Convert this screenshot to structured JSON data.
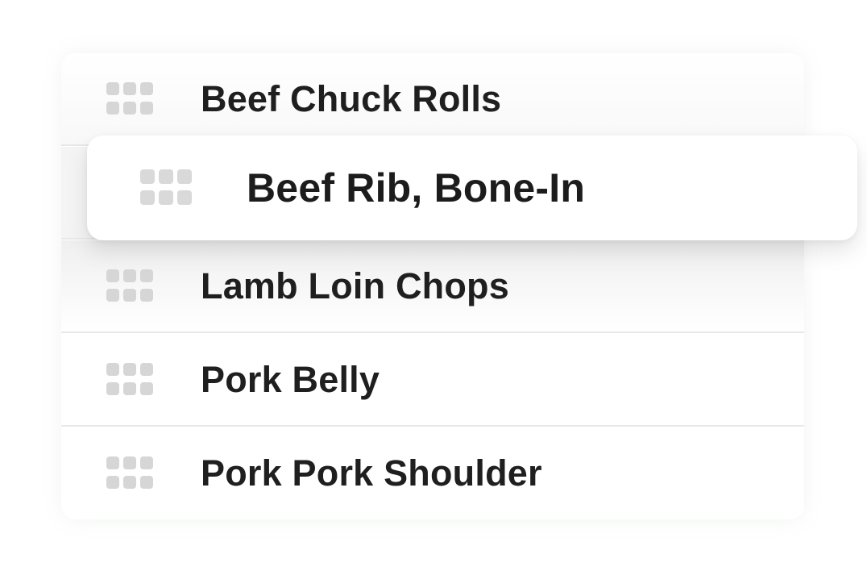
{
  "list": {
    "items": [
      {
        "label": "Beef Chuck Rolls",
        "handle_icon": "drag-handle-icon"
      },
      {
        "label": "",
        "handle_icon": ""
      },
      {
        "label": "Lamb Loin Chops",
        "handle_icon": "drag-handle-icon"
      },
      {
        "label": "Pork Belly",
        "handle_icon": "drag-handle-icon"
      },
      {
        "label": "Pork Pork Shoulder",
        "handle_icon": "drag-handle-icon"
      }
    ]
  },
  "dragging": {
    "label": "Beef Rib, Bone-In",
    "handle_icon": "drag-handle-icon"
  },
  "colors": {
    "text": "#1f1f1f",
    "handle": "#d6d6d6",
    "divider": "#e8e8e8"
  }
}
